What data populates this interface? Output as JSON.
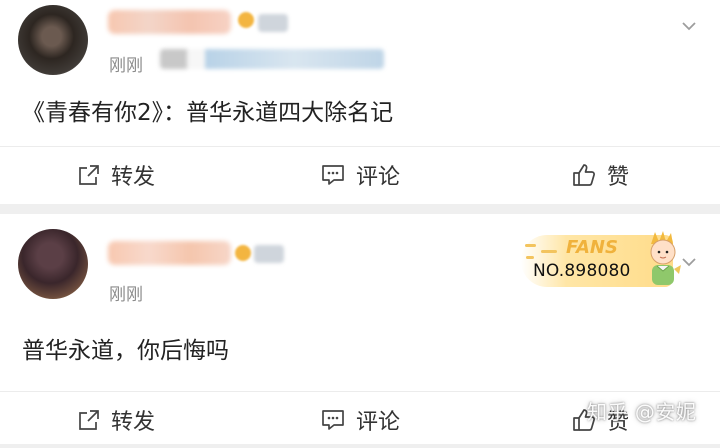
{
  "posts": [
    {
      "time": "刚刚",
      "content": "《青春有你2》：普华永道四大除名记",
      "actions": {
        "share": "转发",
        "comment": "评论",
        "like": "赞"
      }
    },
    {
      "time": "刚刚",
      "content": "普华永道，你后悔吗",
      "actions": {
        "share": "转发",
        "comment": "评论",
        "like": "赞"
      },
      "fans_badge": {
        "title": "FANS",
        "number": "NO.898080"
      }
    }
  ],
  "watermark": "知乎 @安妮",
  "colors": {
    "text_primary": "#222222",
    "text_secondary": "#8b8b8b",
    "badge_gold": "#f0b23c",
    "background": "#efefef"
  },
  "icons": [
    "share-icon",
    "comment-icon",
    "like-icon",
    "chevron-down-icon"
  ]
}
